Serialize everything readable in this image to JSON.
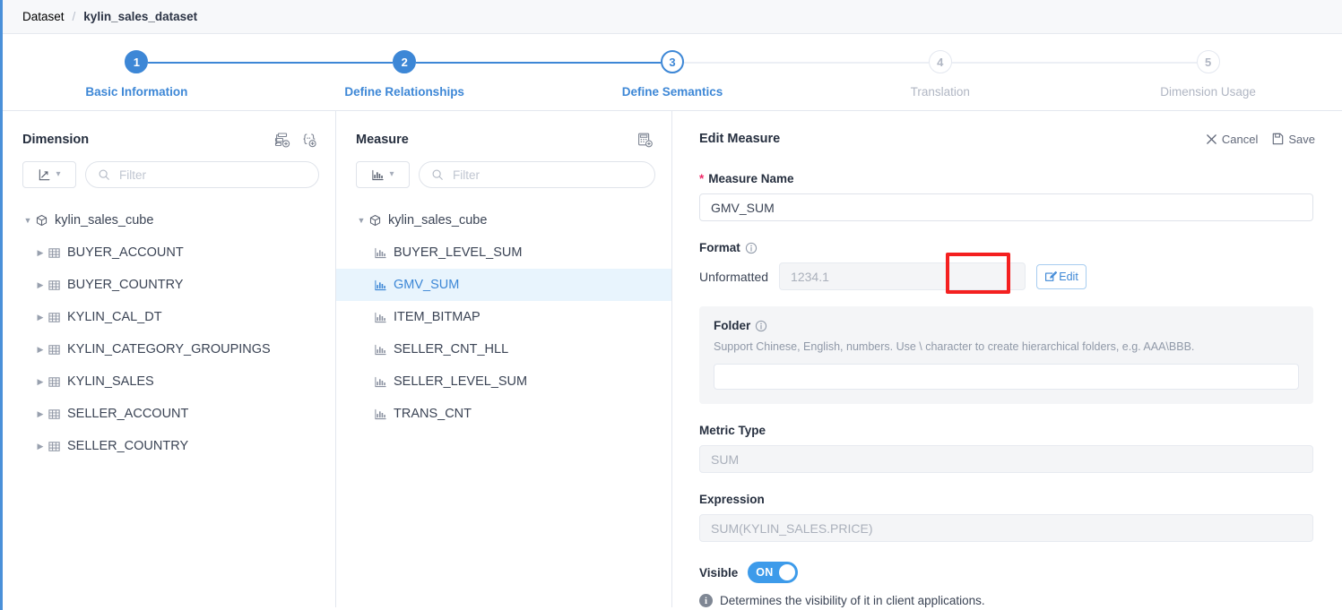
{
  "breadcrumb": {
    "root": "Dataset",
    "separator": "/",
    "current": "kylin_sales_dataset"
  },
  "stepper": {
    "steps": [
      {
        "num": "1",
        "label": "Basic Information",
        "state": "done"
      },
      {
        "num": "2",
        "label": "Define Relationships",
        "state": "done"
      },
      {
        "num": "3",
        "label": "Define Semantics",
        "state": "active"
      },
      {
        "num": "4",
        "label": "Translation",
        "state": "todo"
      },
      {
        "num": "5",
        "label": "Dimension Usage",
        "state": "todo"
      }
    ]
  },
  "dimension_panel": {
    "title": "Dimension",
    "icons": [
      "add-hierarchy-icon",
      "add-named-set-icon"
    ],
    "type_select_icon": "axis-chart-icon",
    "filter_placeholder": "Filter",
    "filter_value": "",
    "tree": {
      "root": "kylin_sales_cube",
      "tables": [
        "BUYER_ACCOUNT",
        "BUYER_COUNTRY",
        "KYLIN_CAL_DT",
        "KYLIN_CATEGORY_GROUPINGS",
        "KYLIN_SALES",
        "SELLER_ACCOUNT",
        "SELLER_COUNTRY"
      ]
    }
  },
  "measure_panel": {
    "title": "Measure",
    "icons": [
      "add-measure-icon"
    ],
    "type_select_icon": "bar-chart-icon",
    "filter_placeholder": "Filter",
    "filter_value": "",
    "tree": {
      "root": "kylin_sales_cube",
      "measures": [
        "BUYER_LEVEL_SUM",
        "GMV_SUM",
        "ITEM_BITMAP",
        "SELLER_CNT_HLL",
        "SELLER_LEVEL_SUM",
        "TRANS_CNT"
      ],
      "selected": "GMV_SUM"
    }
  },
  "edit_panel": {
    "title": "Edit Measure",
    "cancel_label": "Cancel",
    "save_label": "Save",
    "measure_name": {
      "label": "Measure Name",
      "required_mark": "*",
      "value": "GMV_SUM"
    },
    "format": {
      "label": "Format",
      "value_label": "Unformatted",
      "sample": "1234.1",
      "edit_button": "Edit"
    },
    "folder": {
      "label": "Folder",
      "hint": "Support Chinese, English, numbers. Use \\ character to create hierarchical folders, e.g. AAA\\BBB.",
      "value": ""
    },
    "metric_type": {
      "label": "Metric Type",
      "value": "SUM"
    },
    "expression": {
      "label": "Expression",
      "value": "SUM(KYLIN_SALES.PRICE)"
    },
    "visible": {
      "label": "Visible",
      "state": "ON",
      "note": "Determines the visibility of it in client applications."
    }
  },
  "colors": {
    "accent": "#3d87d6",
    "toggle_on": "#3d9bea",
    "highlight": "#f42020",
    "selected_row_bg": "#e8f4fd",
    "required": "#ef2a68"
  }
}
